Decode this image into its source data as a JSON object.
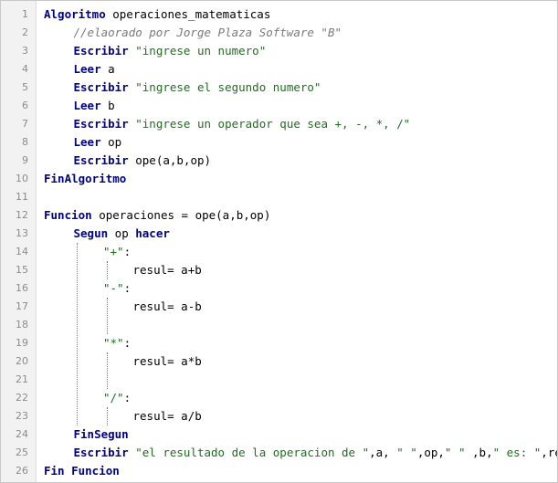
{
  "editor": {
    "lines": [
      {
        "n": "1",
        "indent": 0,
        "tokens": [
          {
            "t": "Algoritmo",
            "k": "kw"
          },
          {
            "t": " operaciones_matematicas",
            "k": "plain"
          }
        ]
      },
      {
        "n": "2",
        "indent": 1,
        "tokens": [
          {
            "t": "//elaorado por Jorge Plaza Software \"B\"",
            "k": "cmt"
          }
        ]
      },
      {
        "n": "3",
        "indent": 1,
        "tokens": [
          {
            "t": "Escribir",
            "k": "kw"
          },
          {
            "t": " ",
            "k": "plain"
          },
          {
            "t": "\"ingrese un numero\"",
            "k": "str"
          }
        ]
      },
      {
        "n": "4",
        "indent": 1,
        "tokens": [
          {
            "t": "Leer",
            "k": "kw"
          },
          {
            "t": " a",
            "k": "plain"
          }
        ]
      },
      {
        "n": "5",
        "indent": 1,
        "tokens": [
          {
            "t": "Escribir",
            "k": "kw"
          },
          {
            "t": " ",
            "k": "plain"
          },
          {
            "t": "\"ingrese el segundo numero\"",
            "k": "str"
          }
        ]
      },
      {
        "n": "6",
        "indent": 1,
        "tokens": [
          {
            "t": "Leer",
            "k": "kw"
          },
          {
            "t": " b",
            "k": "plain"
          }
        ]
      },
      {
        "n": "7",
        "indent": 1,
        "tokens": [
          {
            "t": "Escribir",
            "k": "kw"
          },
          {
            "t": " ",
            "k": "plain"
          },
          {
            "t": "\"ingrese un operador que sea +, -, *, /\"",
            "k": "str"
          }
        ]
      },
      {
        "n": "8",
        "indent": 1,
        "tokens": [
          {
            "t": "Leer",
            "k": "kw"
          },
          {
            "t": " op",
            "k": "plain"
          }
        ]
      },
      {
        "n": "9",
        "indent": 1,
        "tokens": [
          {
            "t": "Escribir",
            "k": "kw"
          },
          {
            "t": " ope(a,b,op)",
            "k": "plain"
          }
        ]
      },
      {
        "n": "10",
        "indent": 0,
        "tokens": [
          {
            "t": "FinAlgoritmo",
            "k": "kw"
          }
        ]
      },
      {
        "n": "11",
        "indent": 0,
        "tokens": []
      },
      {
        "n": "12",
        "indent": 0,
        "tokens": [
          {
            "t": "Funcion",
            "k": "kw"
          },
          {
            "t": " operaciones = ope(a,b,op)",
            "k": "plain"
          }
        ]
      },
      {
        "n": "13",
        "indent": 1,
        "tokens": [
          {
            "t": "Segun",
            "k": "kw"
          },
          {
            "t": " op ",
            "k": "plain"
          },
          {
            "t": "hacer",
            "k": "kw"
          }
        ]
      },
      {
        "n": "14",
        "indent": 2,
        "tokens": [
          {
            "t": "\"+\"",
            "k": "str"
          },
          {
            "t": ":",
            "k": "plain"
          }
        ]
      },
      {
        "n": "15",
        "indent": 3,
        "tokens": [
          {
            "t": "resul= a+b",
            "k": "plain"
          }
        ]
      },
      {
        "n": "16",
        "indent": 2,
        "tokens": [
          {
            "t": "\"-\"",
            "k": "str"
          },
          {
            "t": ":",
            "k": "plain"
          }
        ]
      },
      {
        "n": "17",
        "indent": 3,
        "tokens": [
          {
            "t": "resul= a-b",
            "k": "plain"
          }
        ]
      },
      {
        "n": "18",
        "indent": 0,
        "tokens": []
      },
      {
        "n": "19",
        "indent": 2,
        "tokens": [
          {
            "t": "\"*\"",
            "k": "str"
          },
          {
            "t": ":",
            "k": "plain"
          }
        ]
      },
      {
        "n": "20",
        "indent": 3,
        "tokens": [
          {
            "t": "resul= a*b",
            "k": "plain"
          }
        ]
      },
      {
        "n": "21",
        "indent": 0,
        "tokens": []
      },
      {
        "n": "22",
        "indent": 2,
        "tokens": [
          {
            "t": "\"/\"",
            "k": "str"
          },
          {
            "t": ":",
            "k": "plain"
          }
        ]
      },
      {
        "n": "23",
        "indent": 3,
        "tokens": [
          {
            "t": "resul= a/b",
            "k": "plain"
          }
        ]
      },
      {
        "n": "24",
        "indent": 1,
        "tokens": [
          {
            "t": "FinSegun",
            "k": "kw"
          }
        ]
      },
      {
        "n": "25",
        "indent": 1,
        "tokens": [
          {
            "t": "Escribir",
            "k": "kw"
          },
          {
            "t": " ",
            "k": "plain"
          },
          {
            "t": "\"el resultado de la operacion de \"",
            "k": "str"
          },
          {
            "t": ",a, ",
            "k": "plain"
          },
          {
            "t": "\" \"",
            "k": "str"
          },
          {
            "t": ",op,",
            "k": "plain"
          },
          {
            "t": "\" \"",
            "k": "str"
          },
          {
            "t": " ,b,",
            "k": "plain"
          },
          {
            "t": "\" es: \"",
            "k": "str"
          },
          {
            "t": ",resul",
            "k": "plain"
          }
        ]
      },
      {
        "n": "26",
        "indent": 0,
        "tokens": [
          {
            "t": "Fin Funcion",
            "k": "kw"
          }
        ]
      }
    ]
  },
  "colors": {
    "keyword": "#00008b",
    "string": "#1e6e1e",
    "comment": "#7a7a7a",
    "gutter": "#f2f2f2"
  }
}
